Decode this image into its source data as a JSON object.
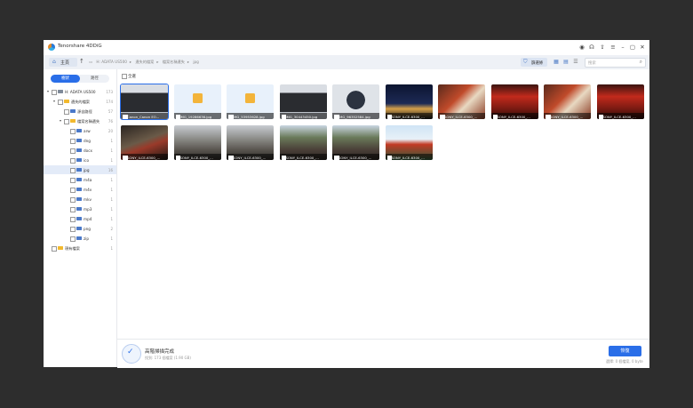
{
  "app": {
    "title": "Tenorshare 4DDiG"
  },
  "window_controls": [
    "discord-icon",
    "headset-icon",
    "share-icon",
    "menu-icon",
    "minimize-icon",
    "maximize-icon",
    "close-icon"
  ],
  "toolbar": {
    "home_label": "主頁",
    "breadcrumbs": [
      "H: ADATA US500",
      "遺失的檔案",
      "檔案名稱遺失",
      "jpg"
    ],
    "filter_label": "篩選條",
    "search_placeholder": "搜索"
  },
  "sidebar": {
    "tabs": [
      "樹狀",
      "路徑"
    ],
    "tree": [
      {
        "label": "H: ADATA US500",
        "count": "173",
        "level": 0,
        "arrow": "▾",
        "icon": "drive",
        "selected": false
      },
      {
        "label": "遺失的檔案",
        "count": "174",
        "level": 1,
        "arrow": "▾",
        "icon": "folder-yellow",
        "selected": false
      },
      {
        "label": "源自路徑",
        "count": "57",
        "level": 2,
        "arrow": "",
        "icon": "folder-blue",
        "selected": false
      },
      {
        "label": "檔案名稱遺失",
        "count": "76",
        "level": 2,
        "arrow": "▾",
        "icon": "folder-yellow",
        "selected": false
      },
      {
        "label": "arw",
        "count": "20",
        "level": 3,
        "arrow": "",
        "icon": "folder-blue",
        "selected": false
      },
      {
        "label": "dng",
        "count": "1",
        "level": 3,
        "arrow": "",
        "icon": "folder-blue",
        "selected": false
      },
      {
        "label": "docx",
        "count": "1",
        "level": 3,
        "arrow": "",
        "icon": "folder-blue",
        "selected": false
      },
      {
        "label": "ico",
        "count": "1",
        "level": 3,
        "arrow": "",
        "icon": "folder-blue",
        "selected": false
      },
      {
        "label": "jpg",
        "count": "16",
        "level": 3,
        "arrow": "",
        "icon": "folder-blue",
        "selected": true
      },
      {
        "label": "m4a",
        "count": "1",
        "level": 3,
        "arrow": "",
        "icon": "folder-blue",
        "selected": false
      },
      {
        "label": "m4v",
        "count": "1",
        "level": 3,
        "arrow": "",
        "icon": "folder-blue",
        "selected": false
      },
      {
        "label": "mkv",
        "count": "1",
        "level": 3,
        "arrow": "",
        "icon": "folder-blue",
        "selected": false
      },
      {
        "label": "mp3",
        "count": "1",
        "level": 3,
        "arrow": "",
        "icon": "folder-blue",
        "selected": false
      },
      {
        "label": "mp4",
        "count": "1",
        "level": 3,
        "arrow": "",
        "icon": "folder-blue",
        "selected": false
      },
      {
        "label": "png",
        "count": "2",
        "level": 3,
        "arrow": "",
        "icon": "folder-blue",
        "selected": false
      },
      {
        "label": "zip",
        "count": "1",
        "level": 3,
        "arrow": "",
        "icon": "folder-blue",
        "selected": false
      },
      {
        "label": "現有檔案",
        "count": "1",
        "level": 0,
        "arrow": "",
        "icon": "folder-yellow",
        "selected": false
      }
    ]
  },
  "content": {
    "select_all_label": "全選",
    "thumbnails": [
      {
        "name": "Canon_Canon EO...",
        "kind": "camera-photo",
        "selected": true
      },
      {
        "name": "IMG_19286636.jpg",
        "kind": "placeholder",
        "selected": false
      },
      {
        "name": "IMG_53953628.jpg",
        "kind": "placeholder",
        "selected": false
      },
      {
        "name": "IMG_30443450.jpg",
        "kind": "camera-photo",
        "selected": false
      },
      {
        "name": "IMG_96352584.jpg",
        "kind": "sdcard-photo",
        "selected": false
      },
      {
        "name": "SONY_ILCE-6300_...",
        "kind": "night-city",
        "selected": false
      },
      {
        "name": "SONY_ILCE-6300_...",
        "kind": "shrine-red",
        "selected": false
      },
      {
        "name": "SONY_ILCE-6300_...",
        "kind": "torii-red",
        "selected": false
      },
      {
        "name": "SONY_ILCE-6300_...",
        "kind": "shrine-red",
        "selected": false
      },
      {
        "name": "SONY_ILCE-6300_...",
        "kind": "torii-red",
        "selected": false
      },
      {
        "name": "SONY_ILCE-6300_...",
        "kind": "dark-street",
        "selected": false
      },
      {
        "name": "SONY_ILCE-6300_...",
        "kind": "grey-street",
        "selected": false
      },
      {
        "name": "SONY_ILCE-6300_...",
        "kind": "grey-street",
        "selected": false
      },
      {
        "name": "SONY_ILCE-6300_...",
        "kind": "town-view",
        "selected": false
      },
      {
        "name": "SONY_ILCE-6300_...",
        "kind": "town-view",
        "selected": false
      },
      {
        "name": "SONY_ILCE-6300_...",
        "kind": "pagoda-sky",
        "selected": false
      }
    ]
  },
  "status": {
    "title": "高階掃描完成",
    "subtitle": "找到: 173 個檔案 (1.90 GB)",
    "recover_label": "恢復",
    "selection_info": "選擇: 0 個檔案, 0 byte"
  },
  "colors": {
    "accent": "#2a6ee8",
    "folder_yellow": "#f2b92d",
    "folder_blue": "#4a78c8"
  }
}
